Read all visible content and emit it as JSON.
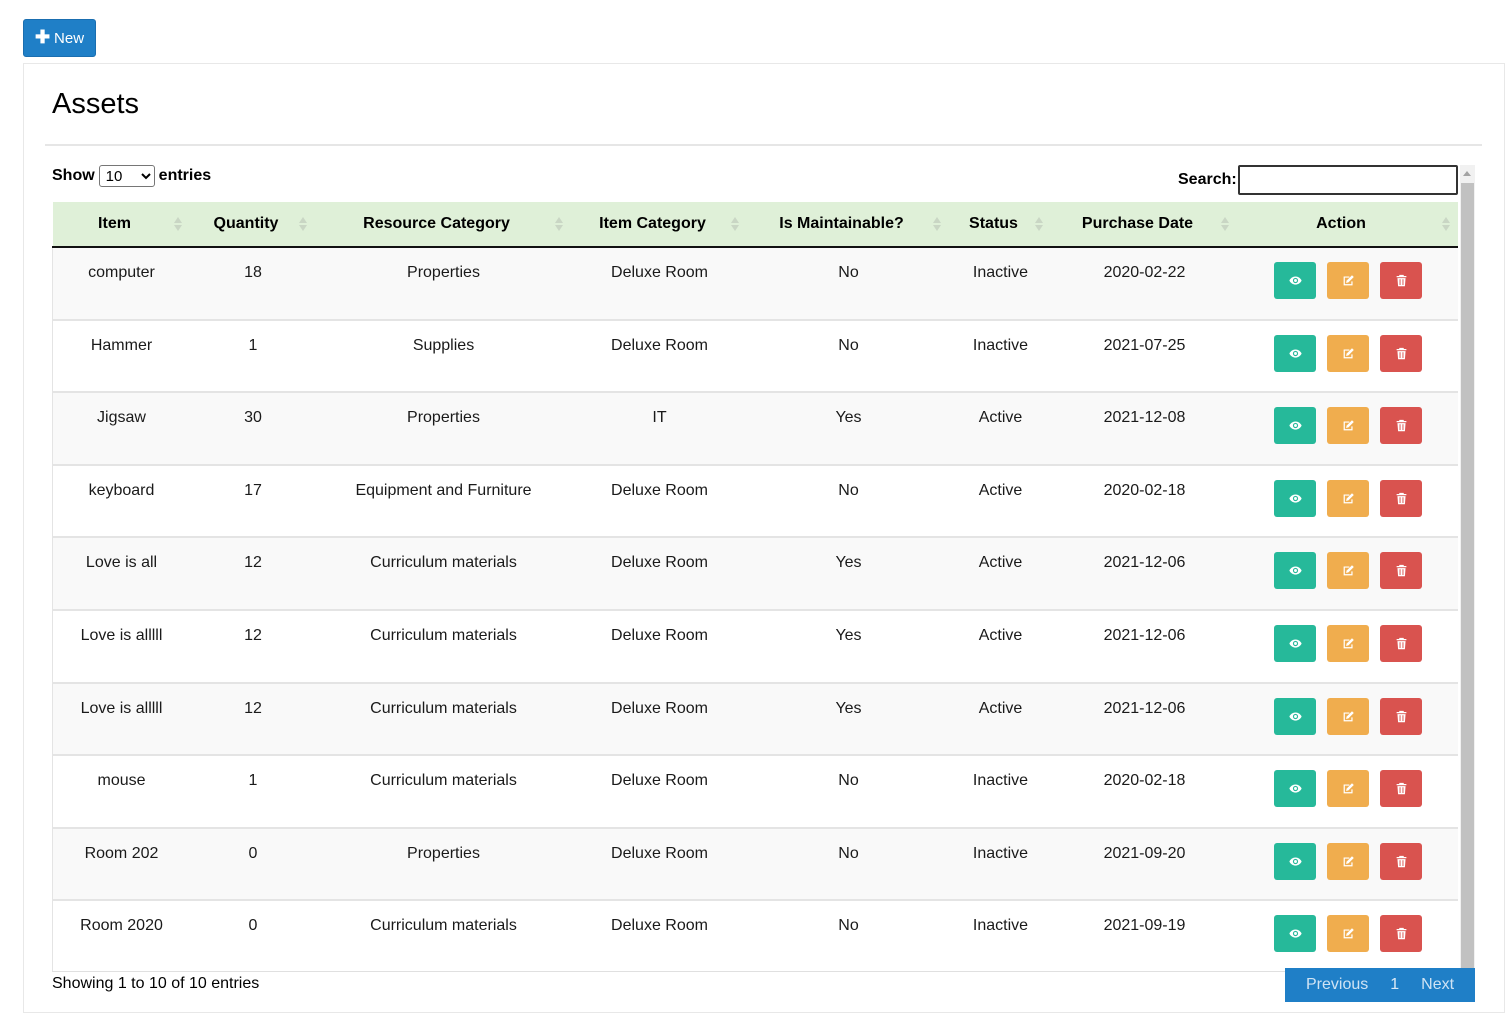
{
  "toolbar": {
    "new_label": "New",
    "new_icon": "plus-icon"
  },
  "page": {
    "title": "Assets"
  },
  "length": {
    "show_label": "Show",
    "selected": "10",
    "entries_label": "entries"
  },
  "search": {
    "label": "Search:",
    "value": ""
  },
  "columns": [
    "Item",
    "Quantity",
    "Resource Category",
    "Item Category",
    "Is Maintainable?",
    "Status",
    "Purchase Date",
    "Action"
  ],
  "rows": [
    [
      "computer",
      "18",
      "Properties",
      "Deluxe Room",
      "No",
      "Inactive",
      "2020-02-22"
    ],
    [
      "Hammer",
      "1",
      "Supplies",
      "Deluxe Room",
      "No",
      "Inactive",
      "2021-07-25"
    ],
    [
      "Jigsaw",
      "30",
      "Properties",
      "IT",
      "Yes",
      "Active",
      "2021-12-08"
    ],
    [
      "keyboard",
      "17",
      "Equipment and Furniture",
      "Deluxe Room",
      "No",
      "Active",
      "2020-02-18"
    ],
    [
      "Love is all",
      "12",
      "Curriculum materials",
      "Deluxe Room",
      "Yes",
      "Active",
      "2021-12-06"
    ],
    [
      "Love is alllll",
      "12",
      "Curriculum materials",
      "Deluxe Room",
      "Yes",
      "Active",
      "2021-12-06"
    ],
    [
      "Love is alllll",
      "12",
      "Curriculum materials",
      "Deluxe Room",
      "Yes",
      "Active",
      "2021-12-06"
    ],
    [
      "mouse",
      "1",
      "Curriculum materials",
      "Deluxe Room",
      "No",
      "Inactive",
      "2020-02-18"
    ],
    [
      "Room 202",
      "0",
      "Properties",
      "Deluxe Room",
      "No",
      "Inactive",
      "2021-09-20"
    ],
    [
      "Room 2020",
      "0",
      "Curriculum materials",
      "Deluxe Room",
      "No",
      "Inactive",
      "2021-09-19"
    ]
  ],
  "actions": {
    "view_icon": "eye-icon",
    "edit_icon": "edit-icon",
    "delete_icon": "trash-icon",
    "colors": {
      "view": "#26b99a",
      "edit": "#f0ad4e",
      "delete": "#d9534f"
    }
  },
  "footer": {
    "info": "Showing 1 to 10 of 10 entries",
    "previous": "Previous",
    "current_page": "1",
    "next": "Next"
  },
  "colors": {
    "primary": "#1f7fc7",
    "header_bg": "#dff0d8"
  }
}
